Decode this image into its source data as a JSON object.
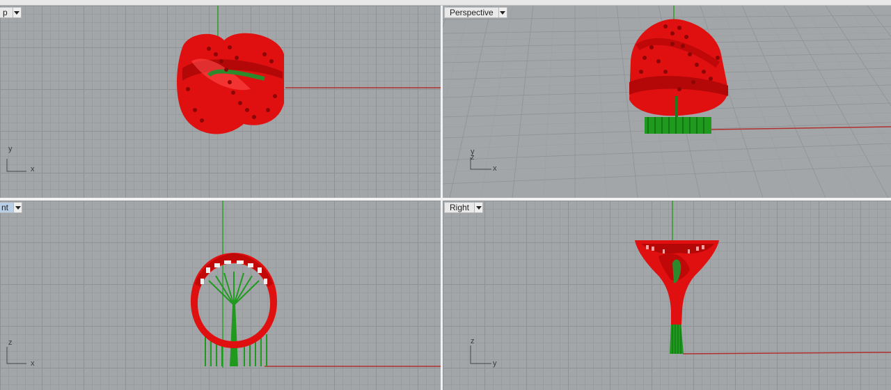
{
  "viewports": {
    "top": {
      "label": "p",
      "axis_a": "y",
      "axis_b": "x"
    },
    "perspective": {
      "label": "Perspective",
      "axis_a": "y",
      "axis_a2": "z",
      "axis_b": "x"
    },
    "front": {
      "label": "nt",
      "axis_a": "z",
      "axis_b": "x"
    },
    "right": {
      "label": "Right",
      "axis_a": "z",
      "axis_b": "y"
    }
  },
  "colors": {
    "grid_bg": "#a3a6a9",
    "model_red": "#e01010",
    "support_green": "#1f9a1f",
    "axis_x_red": "#b03030",
    "axis_y_green": "#2aa02a"
  }
}
